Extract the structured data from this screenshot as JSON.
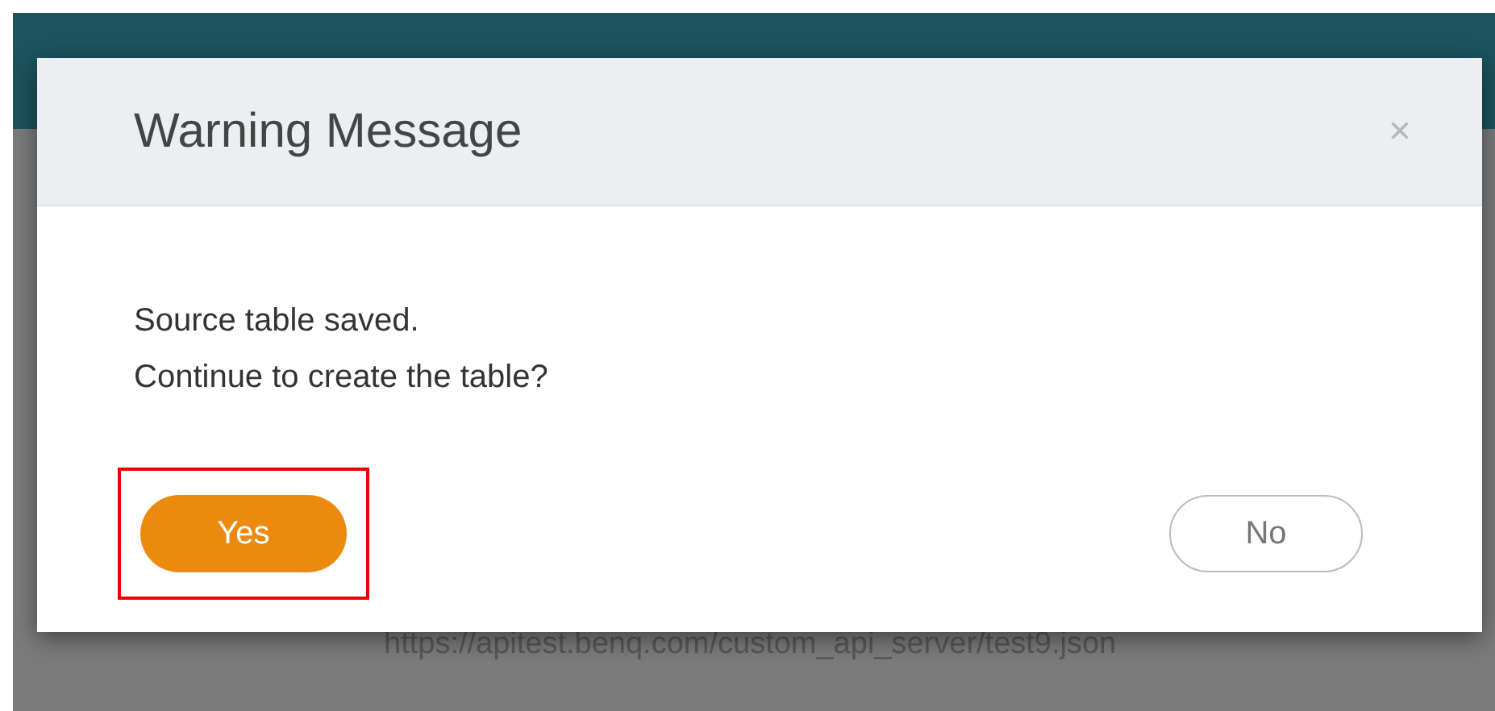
{
  "background": {
    "url": "https://apitest.benq.com/custom_api_server/test9.json"
  },
  "dialog": {
    "title": "Warning Message",
    "close": "×",
    "message": [
      "Source table saved.",
      "Continue to create the table?"
    ],
    "buttons": [
      {
        "label": "Yes",
        "kind": "primary",
        "highlighted": true
      },
      {
        "label": "No",
        "kind": "secondary",
        "highlighted": false
      }
    ]
  }
}
